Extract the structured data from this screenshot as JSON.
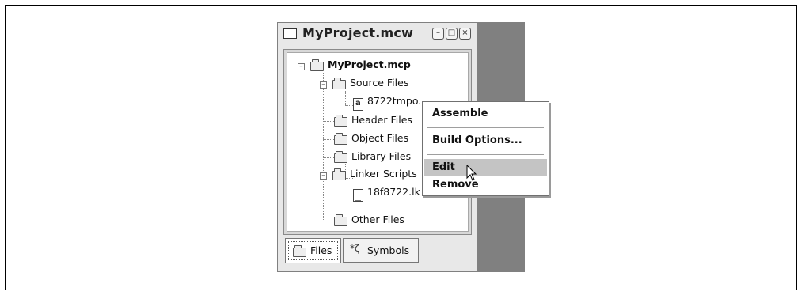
{
  "window": {
    "title": "MyProject.mcw",
    "controls": [
      "–",
      "□",
      "×"
    ]
  },
  "tree": {
    "root": "MyProject.mcp",
    "items": [
      {
        "label": "Source Files",
        "type": "folder",
        "expander": "–"
      },
      {
        "label": "8722tmpo.",
        "type": "file",
        "icon_mark": "a"
      },
      {
        "label": "Header Files",
        "type": "folder"
      },
      {
        "label": "Object Files",
        "type": "folder"
      },
      {
        "label": "Library Files",
        "type": "folder"
      },
      {
        "label": "Linker Scripts",
        "type": "folder",
        "expander": "–"
      },
      {
        "label": "18f8722.lk",
        "type": "file",
        "icon_mark": ""
      },
      {
        "label": "Other Files",
        "type": "folder"
      }
    ],
    "root_expander": "–"
  },
  "tabs": [
    {
      "label": "Files",
      "icon": "folder-icon",
      "active": true
    },
    {
      "label": "Symbols",
      "icon": "symbols-icon",
      "active": false
    }
  ],
  "context_menu": {
    "items": [
      "Assemble",
      "Build Options...",
      "Edit",
      "Remove"
    ],
    "highlighted": "Edit"
  },
  "colors": {
    "side_panel": "#808080",
    "highlight": "#c4c4c4"
  }
}
